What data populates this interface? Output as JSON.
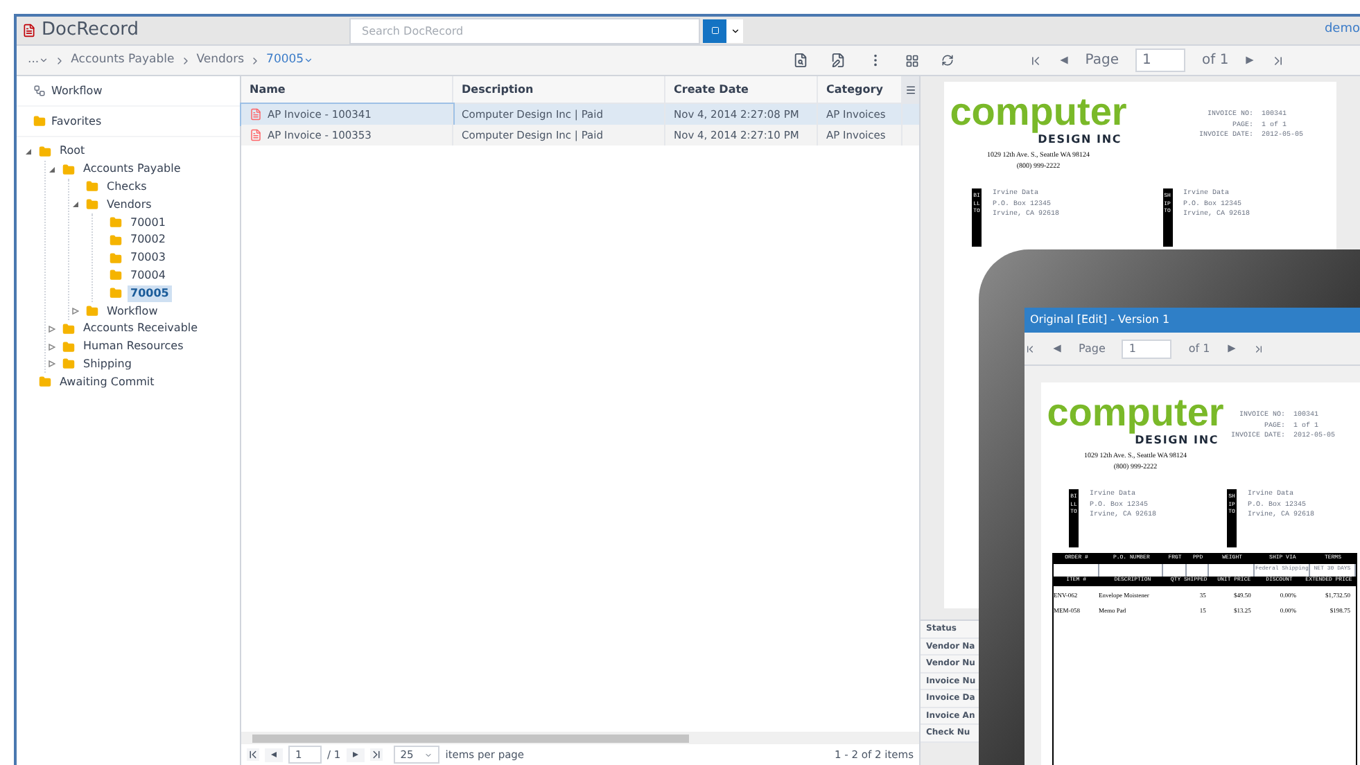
{
  "app": {
    "logo": "DocRecord",
    "search": {
      "placeholder": "Search DocRecord"
    },
    "user": "demo"
  },
  "breadcrumb": [
    {
      "label": "...",
      "selected": false
    },
    {
      "label": "Accounts Payable",
      "selected": false
    },
    {
      "label": "Vendors",
      "selected": false
    },
    {
      "label": "70005",
      "selected": true
    }
  ],
  "sidebar": {
    "shortcuts": [
      {
        "label": "Workflow",
        "kind": "workflow"
      },
      {
        "label": "Favorites",
        "kind": "favorites"
      }
    ],
    "tree": [
      {
        "label": "Root",
        "expanded": true,
        "selected": false,
        "children": [
          {
            "label": "Accounts Payable",
            "expanded": true,
            "selected": false,
            "children": [
              {
                "label": "Checks",
                "selected": false
              },
              {
                "label": "Vendors",
                "expanded": true,
                "selected": false,
                "children": [
                  {
                    "label": "70001",
                    "selected": false
                  },
                  {
                    "label": "70002",
                    "selected": false
                  },
                  {
                    "label": "70003",
                    "selected": false
                  },
                  {
                    "label": "70004",
                    "selected": false
                  },
                  {
                    "label": "70005",
                    "selected": true
                  }
                ]
              },
              {
                "label": "Workflow",
                "expanded": false,
                "selected": false
              }
            ]
          },
          {
            "label": "Accounts Receivable",
            "expanded": false,
            "selected": false
          },
          {
            "label": "Human Resources",
            "expanded": false,
            "selected": false
          },
          {
            "label": "Shipping",
            "expanded": false,
            "selected": false
          }
        ]
      },
      {
        "label": "Awaiting Commit",
        "selected": false
      }
    ]
  },
  "table": {
    "columns": [
      "Name",
      "Description",
      "Create Date",
      "Category"
    ],
    "rows": [
      {
        "cells": [
          "AP Invoice - 100341",
          "Computer Design Inc | Paid",
          "Nov 4, 2014 2:27:08 PM",
          "AP Invoices"
        ],
        "selected": true
      },
      {
        "cells": [
          "AP Invoice - 100353",
          "Computer Design Inc | Paid",
          "Nov 4, 2014 2:27:10 PM",
          "AP Invoices"
        ],
        "selected": false
      }
    ]
  },
  "pager": {
    "page": "1",
    "of": "/ 1",
    "per_page": "25",
    "per_page_label": "items per page",
    "summary": "1 - 2 of 2 items"
  },
  "preview": {
    "pager": {
      "label": "Page",
      "page": "1",
      "of": "of 1"
    },
    "invoice": {
      "logo_main": "computer",
      "logo_sub": "DESIGN INC",
      "address": "1029 12th Ave. S., Seattle WA 98124",
      "phone": "(800) 999-2222",
      "meta": [
        {
          "label": "INVOICE NO:",
          "value": "100341"
        },
        {
          "label": "PAGE:",
          "value": "1 of 1"
        },
        {
          "label": "INVOICE DATE:",
          "value": "2012-05-05"
        }
      ],
      "parties": [
        {
          "tag": "BILL TO",
          "lines": [
            "Irvine Data",
            "P.O. Box 12345",
            "Irvine, CA 92618"
          ]
        },
        {
          "tag": "SHIP TO",
          "lines": [
            "Irvine Data",
            "P.O. Box 12345",
            "Irvine, CA 92618"
          ]
        }
      ]
    },
    "properties": [
      "Status",
      "Vendor Na",
      "Vendor Nu",
      "Invoice Nu",
      "Invoice Da",
      "Invoice An",
      "Check Nu"
    ]
  },
  "tablet": {
    "title": "Original [Edit] - Version 1",
    "pager": {
      "label": "Page",
      "page": "1",
      "of": "of 1"
    },
    "invoice": {
      "logo_main": "computer",
      "logo_sub": "DESIGN INC",
      "address": "1029 12th Ave. S., Seattle WA 98124",
      "phone": "(800) 999-2222",
      "meta": [
        {
          "label": "INVOICE NO:",
          "value": "100341"
        },
        {
          "label": "PAGE:",
          "value": "1 of 1"
        },
        {
          "label": "INVOICE DATE:",
          "value": "2012-05-05"
        }
      ],
      "parties": [
        {
          "tag": "BILL TO",
          "lines": [
            "Irvine Data",
            "P.O. Box 12345",
            "Irvine, CA 92618"
          ]
        },
        {
          "tag": "SHIP TO",
          "lines": [
            "Irvine Data",
            "P.O. Box 12345",
            "Irvine, CA 92618"
          ]
        }
      ],
      "order_columns": [
        "ORDER #",
        "P.O. NUMBER",
        "FRGT",
        "PPD",
        "WEIGHT",
        "SHIP VIA",
        "TERMS"
      ],
      "order_values": {
        "ship_via": "Federal Shipping",
        "terms": "NET 30 DAYS"
      },
      "item_columns": [
        "ITEM #",
        "DESCRIPTION",
        "QTY SHIPPED",
        "UNIT PRICE",
        "DISCOUNT",
        "EXTENDED PRICE"
      ],
      "items": [
        [
          "ENV-062",
          "Envelope Moistener",
          "35",
          "$49.50",
          "0.00%",
          "$1,732.50"
        ],
        [
          "MEM-058",
          "Memo Pad",
          "15",
          "$13.25",
          "0.00%",
          "$198.75"
        ]
      ]
    }
  }
}
